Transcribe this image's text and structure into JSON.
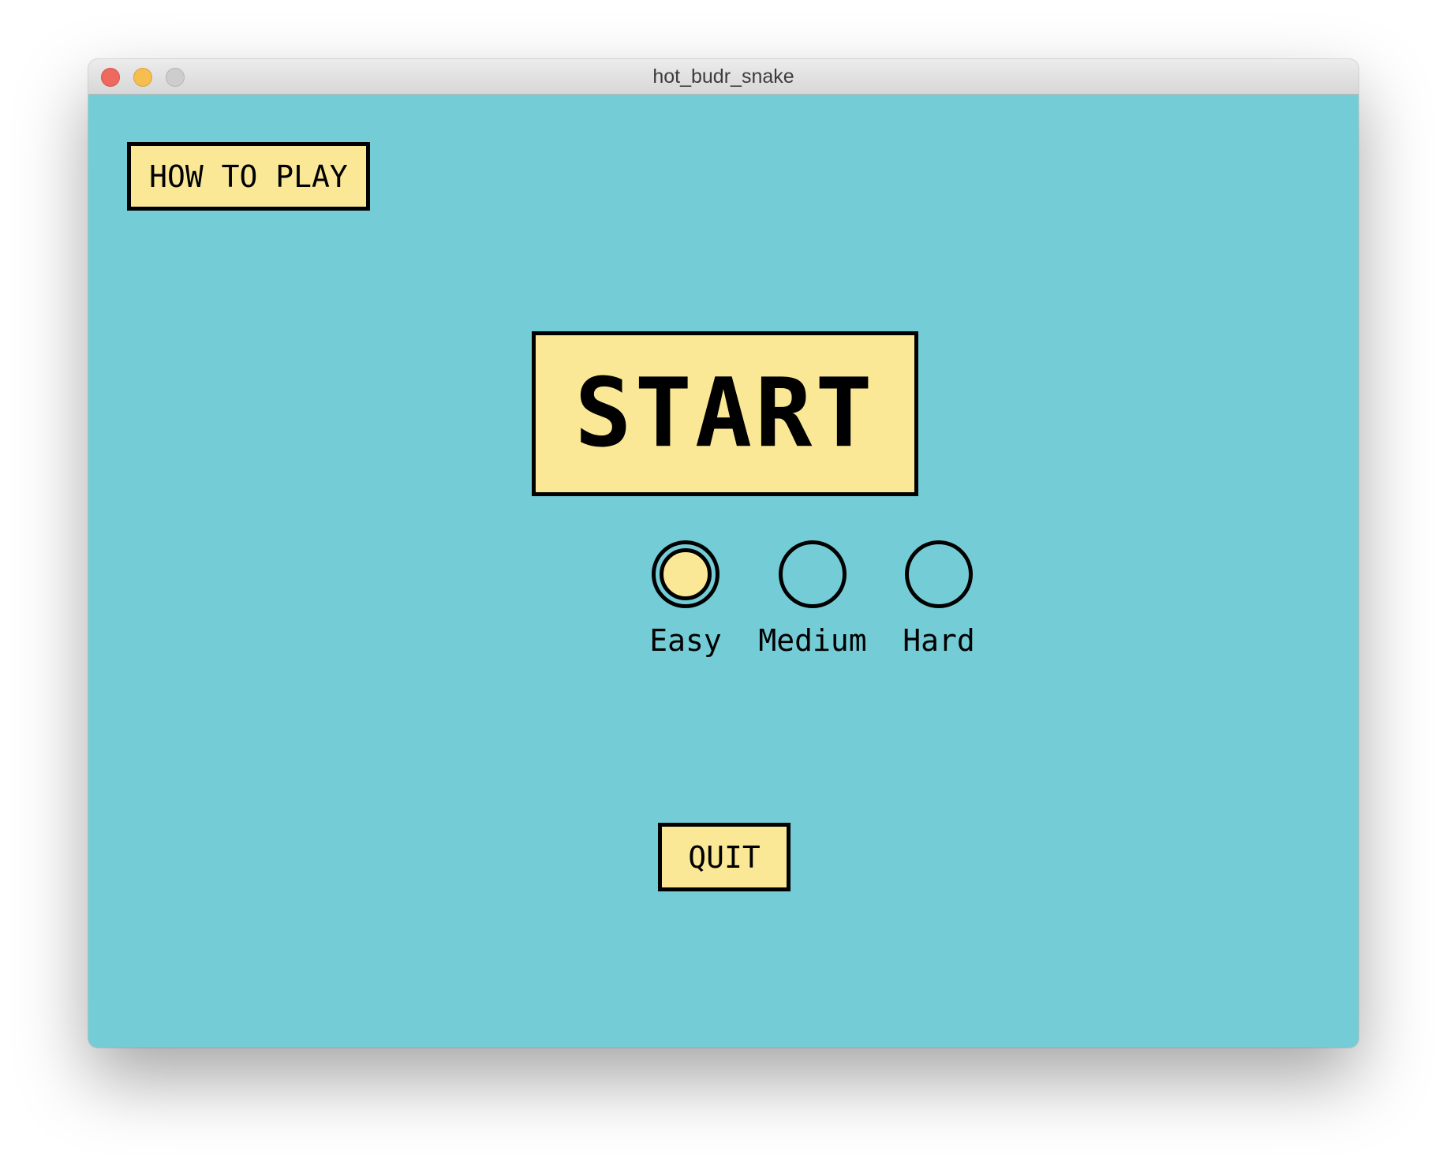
{
  "window": {
    "title": "hot_budr_snake"
  },
  "menu": {
    "how_to_play_label": "HOW TO PLAY",
    "start_label": "START",
    "quit_label": "QUIT"
  },
  "difficulty": {
    "options": [
      {
        "label": "Easy",
        "selected": true
      },
      {
        "label": "Medium",
        "selected": false
      },
      {
        "label": "Hard",
        "selected": false
      }
    ]
  },
  "colors": {
    "background": "#74cdd6",
    "button_fill": "#fbe897",
    "border": "#000000"
  }
}
